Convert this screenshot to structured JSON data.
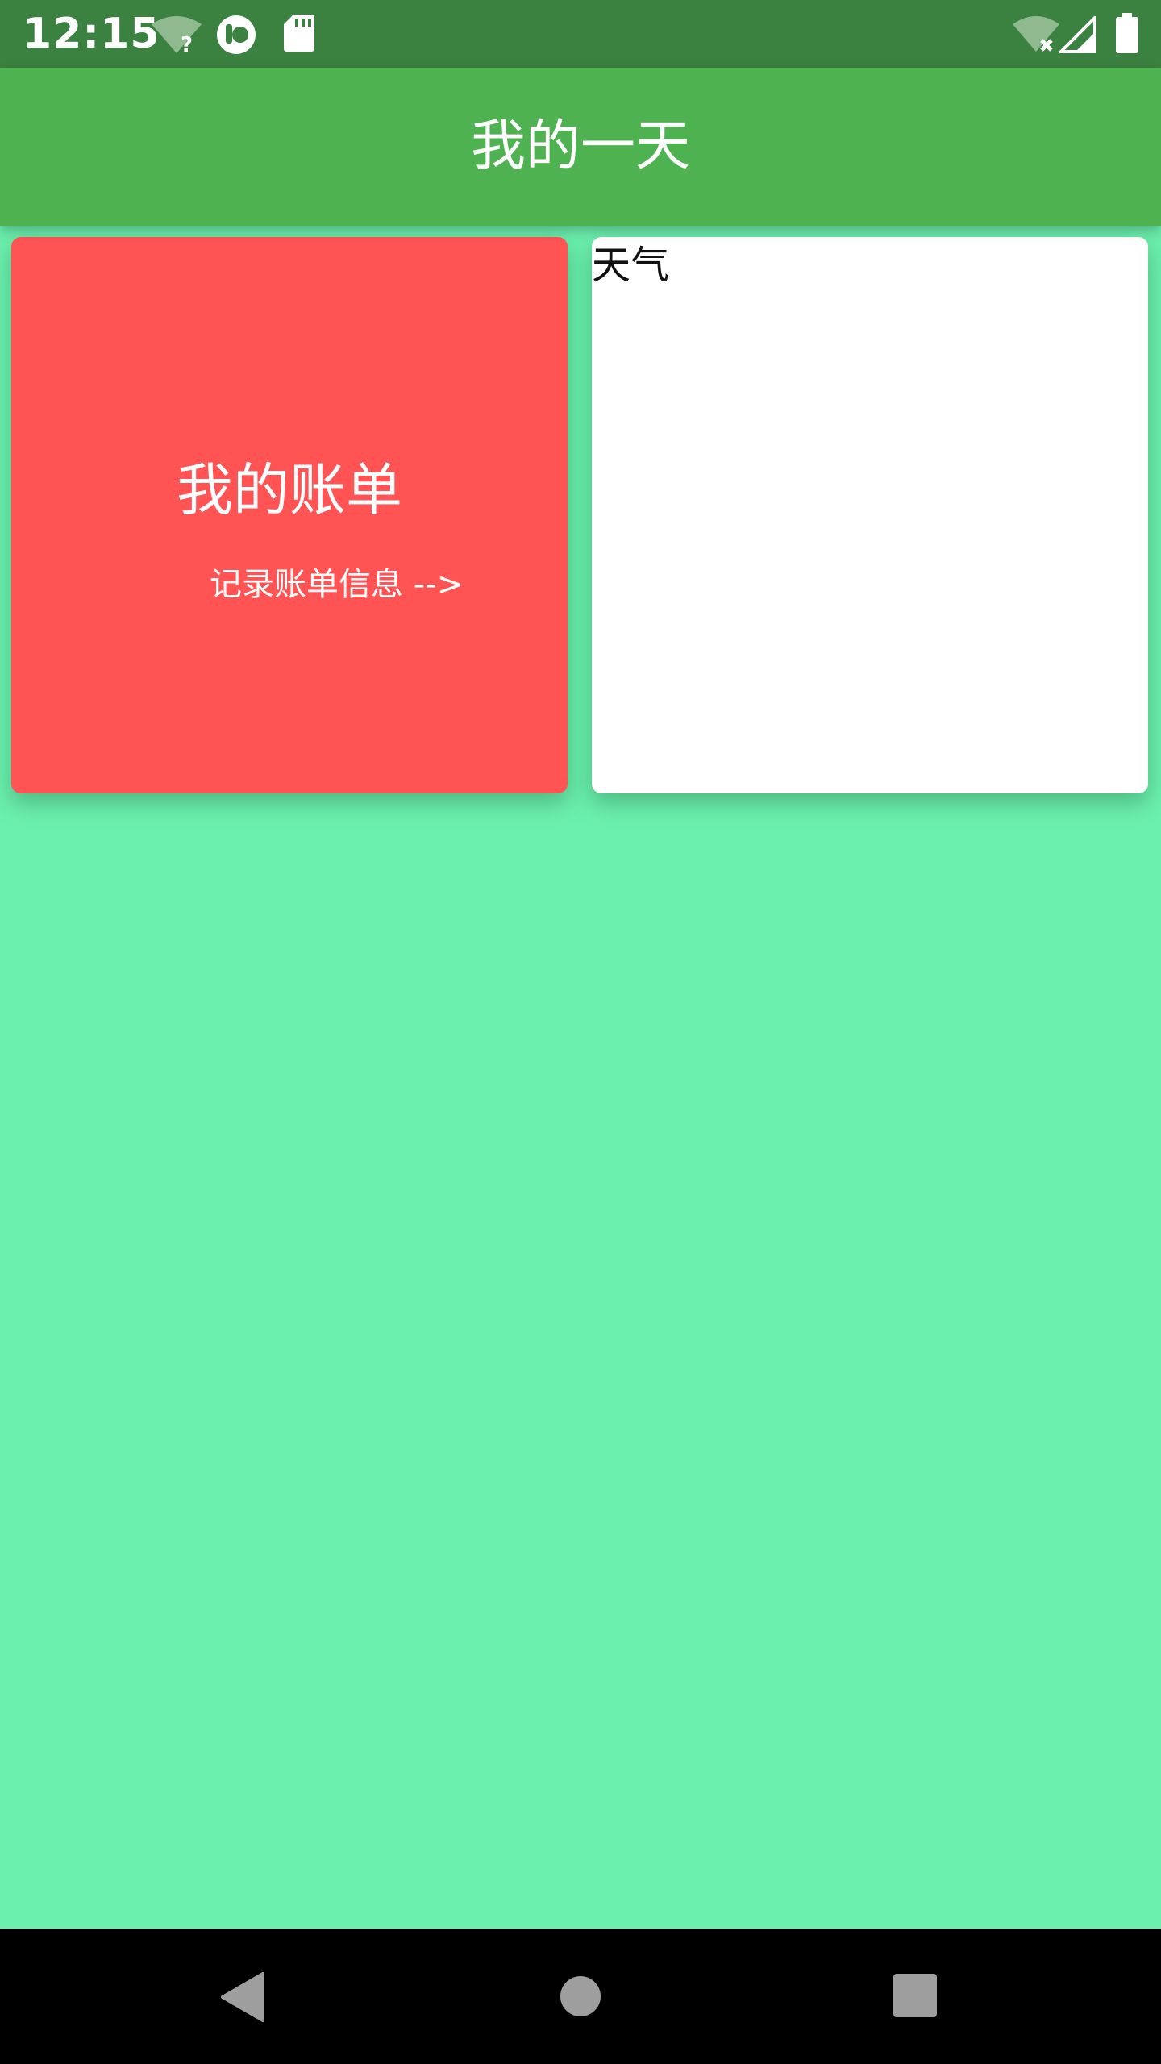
{
  "status_bar": {
    "time": "12:15",
    "left_icons": [
      "wifi-unknown-icon",
      "app-notification-icon",
      "sd-card-icon"
    ],
    "right_icons": [
      "wifi-off-icon",
      "cell-signal-icon",
      "battery-icon"
    ]
  },
  "app_bar": {
    "title": "我的一天"
  },
  "cards": {
    "bill": {
      "title": "我的账单",
      "subtitle": "记录账单信息 -->"
    },
    "weather": {
      "label": "天气"
    }
  },
  "nav_bar": {
    "buttons": [
      "back-icon",
      "home-icon",
      "recents-icon"
    ]
  },
  "colors": {
    "status_bar": "#3B8140",
    "app_bar": "#4FB250",
    "background": "#6CF0AD",
    "bill_card": "#FF5354",
    "weather_card": "#FFFFFF"
  }
}
